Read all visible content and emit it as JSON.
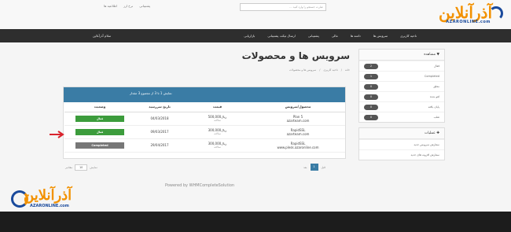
{
  "brand": {
    "logo_text": "آذرآنلاین",
    "logo_sub": "AZARONLINE.com",
    "accent": "#f29100",
    "brand_blue": "#1a4a9c"
  },
  "toplinks": [
    "اطلاعیه ها",
    "نرخ ارز",
    "پشتیبانی"
  ],
  "nav": {
    "items": [
      "ناحیه کاربری",
      "سرویس ها",
      "دامنه ها",
      "مالی",
      "پشتیبانی",
      "ارسال تیکت پشتیبانی",
      "بازاریابی"
    ],
    "account": "سلام آذرآنلاین"
  },
  "page": {
    "title": "سرویس ها و محصولات",
    "breadcrumb": [
      "خانه",
      "ناحیه کاربری",
      "سرویس ها و محصولات"
    ]
  },
  "sidebar": {
    "panel1_title": "مشاهده",
    "filters": [
      {
        "label": "فعال",
        "count": "2"
      },
      {
        "label": "Completed",
        "count": "1"
      },
      {
        "label": "معلق",
        "count": "0"
      },
      {
        "label": "لغو شده",
        "count": "0"
      },
      {
        "label": "پایان یافته",
        "count": "0"
      },
      {
        "label": "تقلب",
        "count": "0"
      }
    ],
    "panel2_title": "عملیات",
    "actions": [
      "سفارش سرویس جدید",
      "سفارش افزونه های جدید"
    ]
  },
  "table": {
    "search_placeholder": "عبارت جستجو را وارد کنید ...",
    "showing": "نمایش 1 تا 3 از مجموع 3 مقدار",
    "headers": [
      "محصول/سرویس",
      "قیمت",
      "تاریخ سررسید",
      "وضعیت"
    ],
    "rows": [
      {
        "product": "Plan 5",
        "domain": "azarteam.com",
        "price": "500,000ریال",
        "cycle": "سالانه",
        "due": "04/03/2018",
        "status": "فعال",
        "status_type": "active"
      },
      {
        "product": "RapidSSL",
        "domain": "azarteam.com",
        "price": "300,000ریال",
        "cycle": "سالانه",
        "due": "09/03/2017",
        "status": "فعال",
        "status_type": "active"
      },
      {
        "product": "RapidSSL",
        "domain": "www.plesk.azaronline.com",
        "price": "300,000ریال",
        "cycle": "سالانه",
        "due": "29/04/2017",
        "status": "Completed",
        "status_type": "completed"
      }
    ]
  },
  "pagination": {
    "prev": "قبل",
    "page": "1",
    "next": "بعد"
  },
  "perpage": {
    "label": "نمایش",
    "value": "10",
    "suffix": "مقادیر"
  },
  "footer": {
    "powered": "Powered by WHMCompleteSolution"
  },
  "colors": {
    "table_header": "#3a7ca5",
    "active": "#3c9c3c",
    "completed": "#777777",
    "arrow": "#d9232d"
  }
}
